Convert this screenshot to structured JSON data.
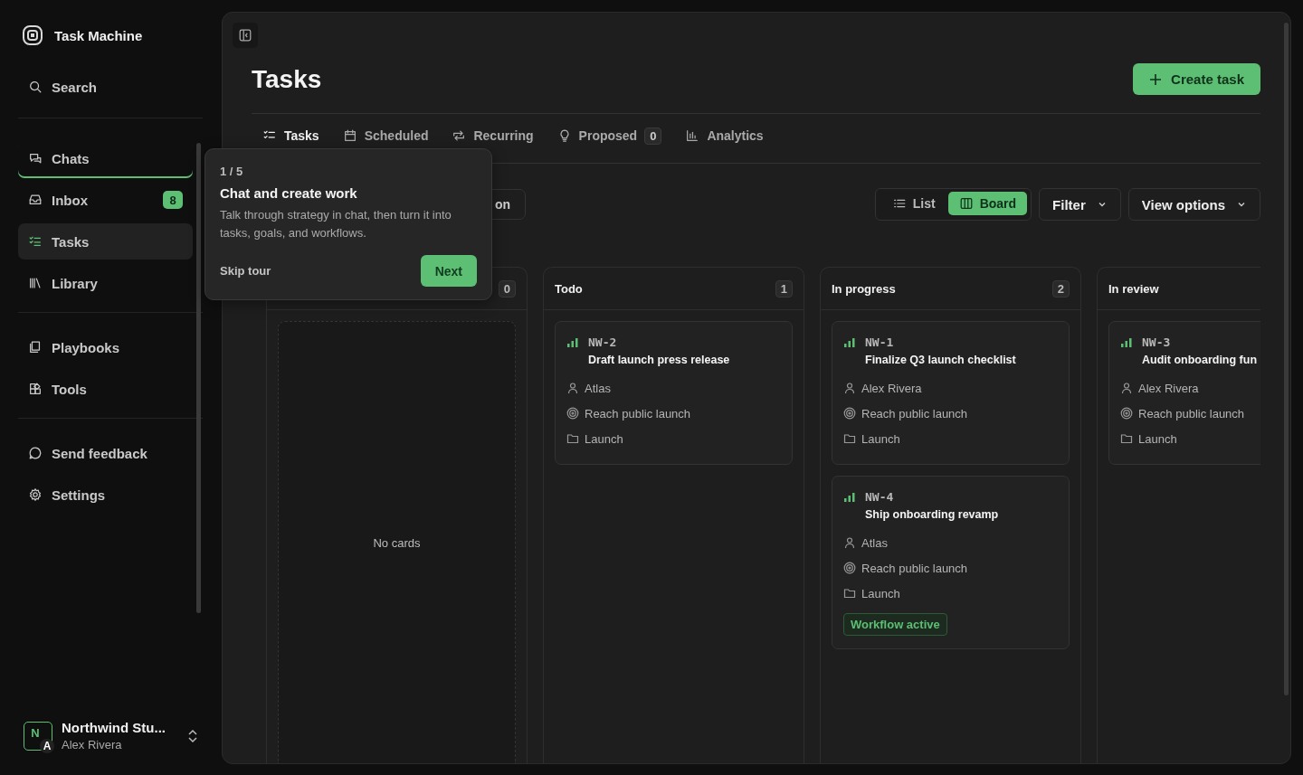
{
  "sidebar": {
    "app_name": "Task Machine",
    "search_label": "Search",
    "nav_groups": [
      [
        {
          "label": "Chats",
          "selected": false,
          "tour_focus": true
        },
        {
          "label": "Inbox",
          "selected": false,
          "tour_focus": false,
          "badge": "8"
        },
        {
          "label": "Tasks",
          "selected": true,
          "tour_focus": false
        },
        {
          "label": "Library",
          "selected": false,
          "tour_focus": false
        }
      ],
      [
        {
          "label": "Playbooks",
          "selected": false,
          "tour_focus": false
        },
        {
          "label": "Tools",
          "selected": false,
          "tour_focus": false
        }
      ],
      [
        {
          "label": "Send feedback",
          "selected": false,
          "tour_focus": false
        },
        {
          "label": "Settings",
          "selected": false,
          "tour_focus": false
        }
      ]
    ],
    "workspace": {
      "avatar_letter": "N",
      "user_letter": "A",
      "name": "Northwind Stu...",
      "user": "Alex Rivera"
    }
  },
  "page": {
    "title": "Tasks",
    "create_button": "Create task",
    "tabs": [
      {
        "label": "Tasks",
        "selected": true
      },
      {
        "label": "Scheduled",
        "selected": false
      },
      {
        "label": "Recurring",
        "selected": false
      },
      {
        "label": "Proposed",
        "selected": false,
        "count": "0"
      },
      {
        "label": "Analytics",
        "selected": false
      }
    ],
    "toolbar_left_button": "on",
    "view_toggle": [
      {
        "label": "List",
        "selected": false
      },
      {
        "label": "Board",
        "selected": true
      }
    ],
    "filter": "Filter",
    "view_options": "View options"
  },
  "board": {
    "columns": [
      {
        "count": "0",
        "empty_text": "No cards"
      },
      {
        "title": "Todo",
        "count": "1",
        "cards": [
          {
            "id": "NW-2",
            "title": "Draft launch press release",
            "assignee": "Atlas",
            "goal": "Reach public launch",
            "project": "Launch"
          }
        ]
      },
      {
        "title": "In progress",
        "count": "2",
        "cards": [
          {
            "id": "NW-1",
            "title": "Finalize Q3 launch checklist",
            "assignee": "Alex Rivera",
            "goal": "Reach public launch",
            "project": "Launch"
          },
          {
            "id": "NW-4",
            "title": "Ship onboarding revamp",
            "assignee": "Atlas",
            "goal": "Reach public launch",
            "project": "Launch",
            "tag": "Workflow active"
          }
        ]
      },
      {
        "title": "In review",
        "cards": [
          {
            "id": "NW-3",
            "title": "Audit onboarding fun",
            "assignee": "Alex Rivera",
            "goal": "Reach public launch",
            "project": "Launch"
          }
        ]
      }
    ]
  },
  "tour": {
    "step": "1 / 5",
    "title": "Chat and create work",
    "body": "Talk through strategy in chat, then turn it into tasks, goals, and workflows.",
    "skip": "Skip tour",
    "next": "Next"
  }
}
